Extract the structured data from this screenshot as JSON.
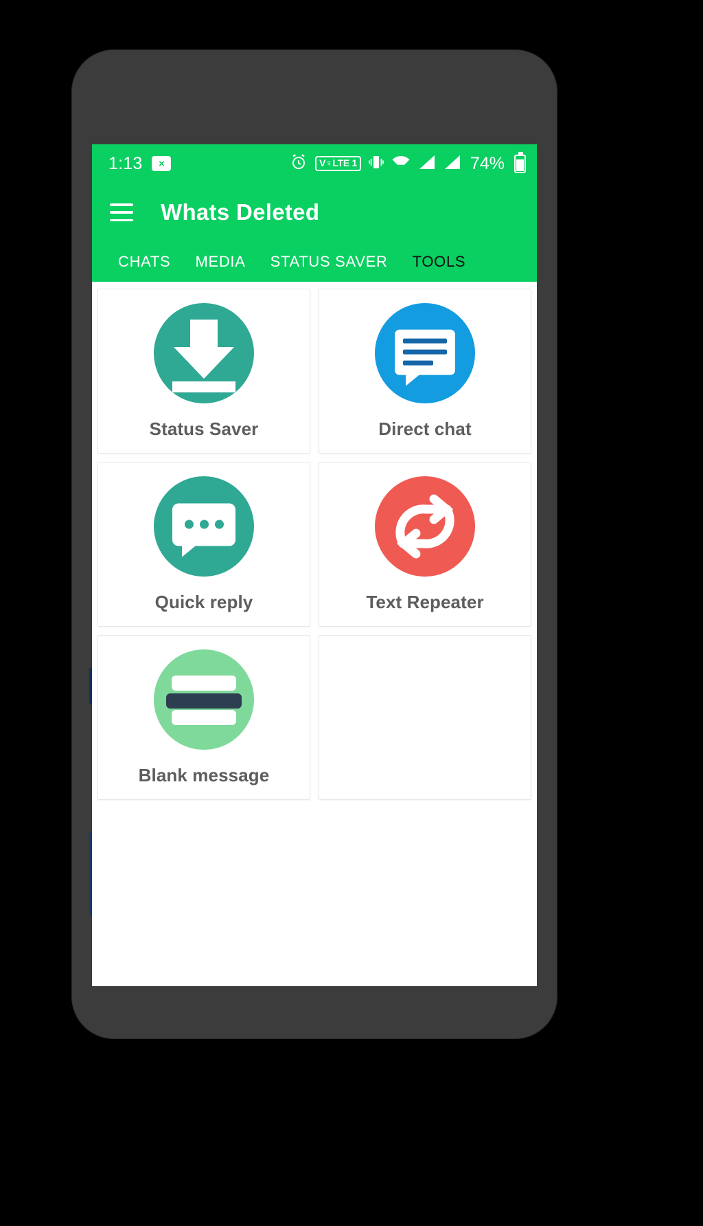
{
  "statusbar": {
    "time": "1:13",
    "close_badge": "×",
    "alarm_icon": "alarm-clock-icon",
    "volte_label": "V♀LTE 1",
    "vibrate_icon": "vibrate-icon",
    "wifi_icon": "wifi-icon",
    "signal_icon": "signal-bars-icon",
    "battery_text": "74%",
    "battery_icon": "battery-icon"
  },
  "toolbar": {
    "menu_icon": "hamburger-menu-icon",
    "title": "Whats Deleted"
  },
  "tabs": [
    {
      "label": "CHATS",
      "active": false
    },
    {
      "label": "MEDIA",
      "active": false
    },
    {
      "label": "STATUS SAVER",
      "active": false
    },
    {
      "label": "TOOLS",
      "active": true
    }
  ],
  "tools": [
    {
      "label": "Status Saver",
      "icon": "download-arrow-icon",
      "color": "#2FA894"
    },
    {
      "label": "Direct chat",
      "icon": "speech-bubble-icon",
      "color": "#139CE0"
    },
    {
      "label": "Quick reply",
      "icon": "chat-dots-icon",
      "color": "#2FA894"
    },
    {
      "label": "Text Repeater",
      "icon": "repeat-arrows-icon",
      "color": "#EF5A52"
    },
    {
      "label": "Blank message",
      "icon": "blank-lines-icon",
      "color": "#7ED99A"
    },
    {
      "label": "",
      "icon": "",
      "color": ""
    }
  ],
  "colors": {
    "brand_green": "#0ACF61",
    "phone_body": "#3c3c3c",
    "background": "#000000",
    "card_label": "#5d5d5d"
  }
}
